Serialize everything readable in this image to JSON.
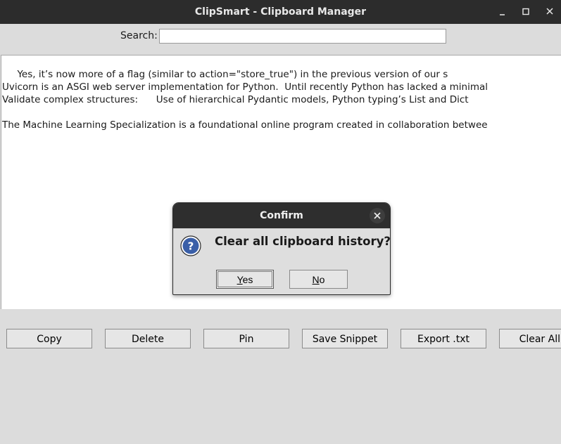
{
  "window": {
    "title": "ClipSmart - Clipboard Manager",
    "minimize_icon": "minimize-icon",
    "maximize_icon": "maximize-icon",
    "close_icon": "close-icon"
  },
  "search": {
    "label": "Search:",
    "value": "",
    "placeholder": ""
  },
  "clipboard_list": {
    "items": [
      "     Yes, it’s now more of a flag (similar to action=\"store_true\") in the previous version of our s",
      "Uvicorn is an ASGI web server implementation for Python.  Until recently Python has lacked a minimal",
      "Validate complex structures:      Use of hierarchical Pydantic models, Python typing’s List and Dict",
      "The Machine Learning Specialization is a foundational online program created in collaboration betwee"
    ]
  },
  "toolbar": {
    "copy": "Copy",
    "delete": "Delete",
    "pin": "Pin",
    "save_snippet": "Save Snippet",
    "export_txt": "Export .txt",
    "clear_all": "Clear All"
  },
  "dialog": {
    "title": "Confirm",
    "icon": "question-icon",
    "message": "Clear all clipboard history?",
    "yes_mnemonic": "Y",
    "yes_rest": "es",
    "no_mnemonic": "N",
    "no_rest": "o"
  },
  "colors": {
    "titlebar": "#2c2c2c",
    "background": "#dcdcdc",
    "dialog_icon": "#3a5fa8"
  }
}
